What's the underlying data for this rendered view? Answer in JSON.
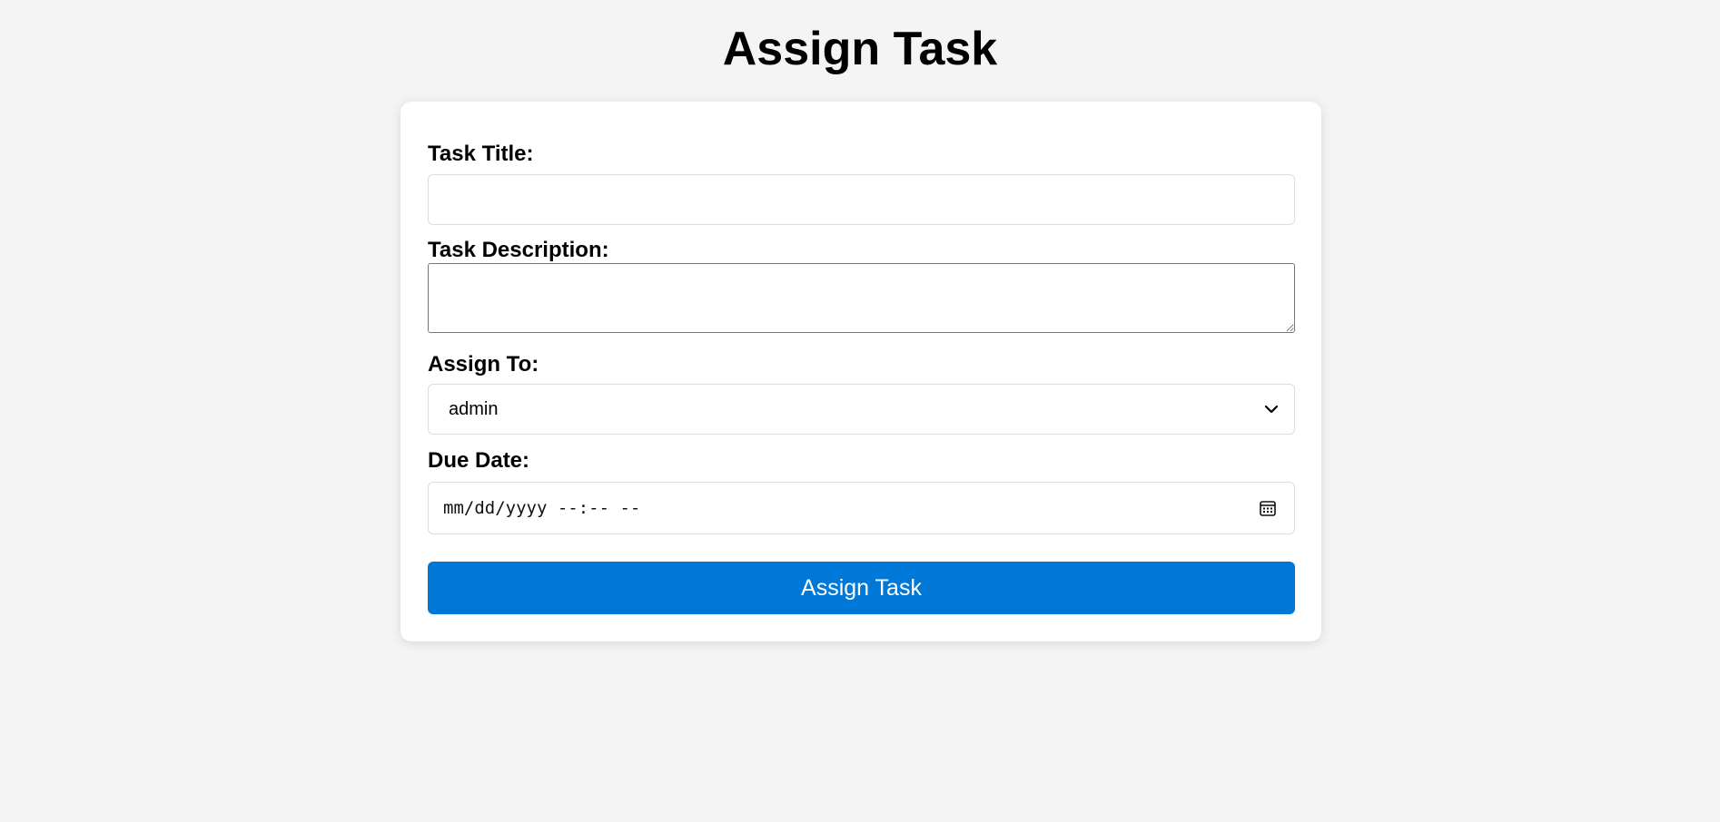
{
  "header": {
    "title": "Assign Task"
  },
  "form": {
    "task_title": {
      "label": "Task Title:",
      "value": ""
    },
    "task_description": {
      "label": "Task Description:",
      "value": ""
    },
    "assign_to": {
      "label": "Assign To:",
      "selected": "admin"
    },
    "due_date": {
      "label": "Due Date:",
      "placeholder": "mm/dd/yyyy --:-- --"
    },
    "submit_label": "Assign Task"
  },
  "icons": {
    "dropdown": "chevron-down-icon",
    "date_picker": "calendar-icon"
  },
  "colors": {
    "background": "#f4f4f4",
    "card": "#ffffff",
    "primary_button": "#0078d7",
    "button_text": "#ffffff"
  }
}
